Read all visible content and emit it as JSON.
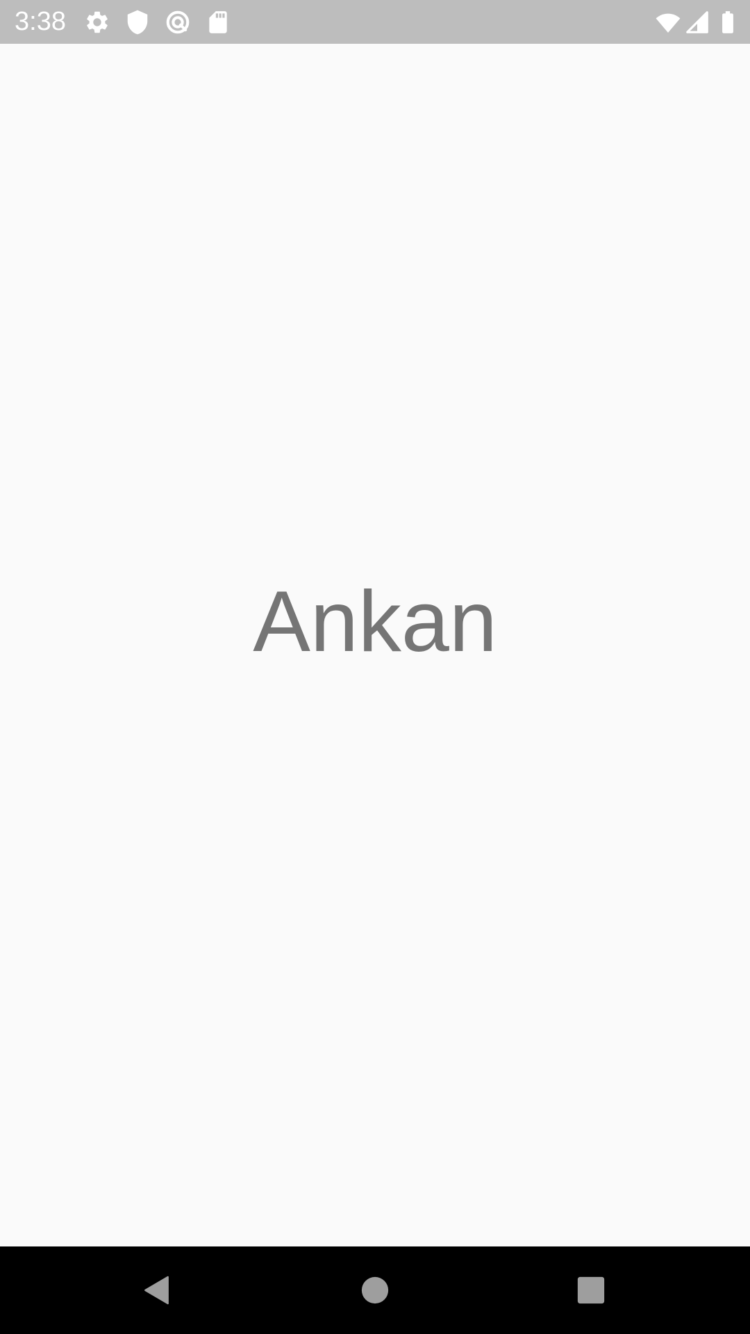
{
  "status_bar": {
    "time": "3:38",
    "left_icons": [
      "gear-icon",
      "shield-icon",
      "data-saver-icon",
      "sd-card-icon"
    ],
    "right_icons": [
      "wifi-icon",
      "cellular-signal-icon",
      "battery-icon"
    ]
  },
  "main": {
    "title": "Ankan"
  },
  "nav_bar": {
    "buttons": [
      "back-icon",
      "home-icon",
      "recents-icon"
    ]
  },
  "colors": {
    "status_bar_bg": "#bdbdbd",
    "background": "#fafafa",
    "title_text": "#757575",
    "nav_bar_bg": "#000000",
    "nav_icon": "#9e9e9e"
  }
}
